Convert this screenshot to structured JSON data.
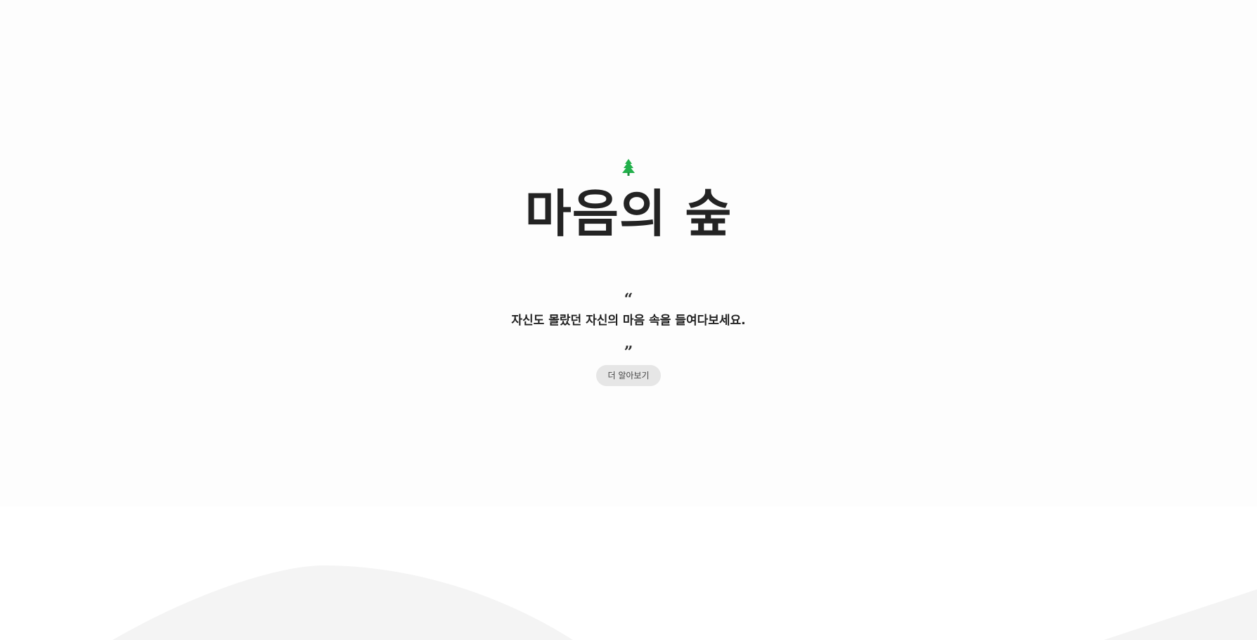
{
  "hero": {
    "icon": "tree-icon",
    "icon_color": "#22b04b",
    "title": "마음의 숲",
    "quote_open": "“",
    "tagline": "자신도 몰랐던 자신의 마음 속을 들여다보세요.",
    "quote_close": "”",
    "button_label": "더 알아보기"
  },
  "colors": {
    "hero_background": "#fdfdfd",
    "lower_background": "#ffffff",
    "wave": "#f4f4f4",
    "button_background": "#e6e6e6",
    "text": "#222222"
  }
}
